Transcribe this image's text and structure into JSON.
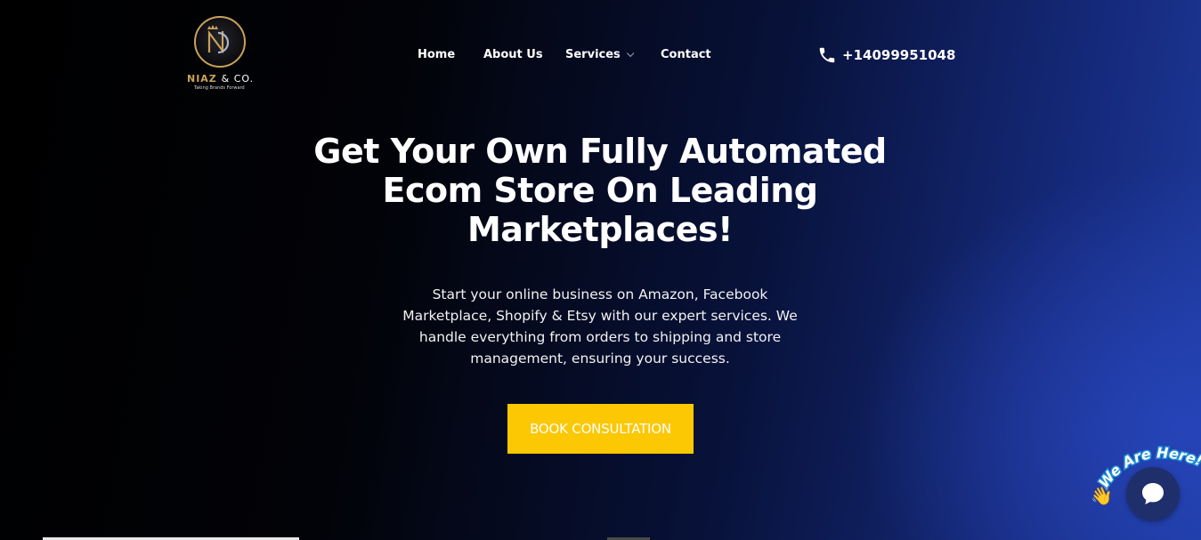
{
  "brand": {
    "name": "NIAZ",
    "suffix": "& CO.",
    "tagline": "Taking Brands Forward",
    "gold_color": "#c9a25a"
  },
  "nav": {
    "items": [
      {
        "label": "Home"
      },
      {
        "label": "About Us"
      },
      {
        "label": "Services",
        "has_dropdown": true
      },
      {
        "label": "Contact"
      }
    ]
  },
  "phone": {
    "icon": "phone-icon",
    "number": "+14099951048"
  },
  "hero": {
    "title": "Get Your Own Fully Automated Ecom Store On Leading Marketplaces!",
    "subtitle": "Start your online business on Amazon, Facebook Marketplace, Shopify & Etsy with our expert services. We handle everything from orders to shipping and store management, ensuring your success.",
    "cta_label": "BOOK CONSULTATION",
    "cta_color": "#fcc703"
  },
  "chat": {
    "label": "We Are Here!",
    "wave_icon": "waving-hand-icon",
    "button_icon": "chat-bubble-icon",
    "label_color": "#ffffff",
    "label_stroke": "#1e8fd6"
  }
}
